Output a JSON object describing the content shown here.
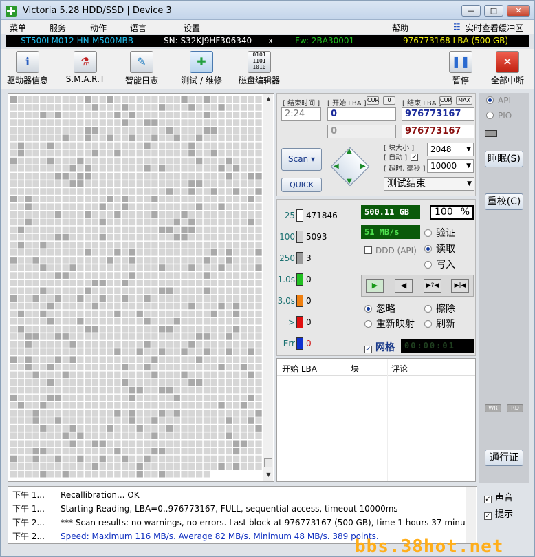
{
  "window": {
    "title": "Victoria 5.28 HDD/SSD | Device 3",
    "min": "—",
    "max": "□",
    "close": "✕"
  },
  "menu": {
    "items": [
      "菜单",
      "服务",
      "动作",
      "语言",
      "设置",
      "帮助"
    ],
    "realtime": "实时查看缓冲区"
  },
  "device": {
    "model": "ST500LM012 HN-M500MBB",
    "serial": "SN: S32KJ9HF306340",
    "x": "x",
    "firmware": "Fw: 2BA30001",
    "capacity": "976773168 LBA (500 GB)"
  },
  "toolbar": {
    "driver_info": "驱动器信息",
    "smart": "S.M.A.R.T",
    "smart_log": "智能日志",
    "test_repair": "测试 / 维修",
    "disk_editor": "磁盘编辑器",
    "pause": "暂停",
    "stop_all": "全部中断"
  },
  "test": {
    "end_time_label": "[ 结束时间 ]",
    "start_lba_label": "[ 开始 LBA ]",
    "end_lba_label": "[ 结束 LBA ]",
    "cur": "CUR",
    "zero": "0",
    "max": "MAX",
    "time": "2:24",
    "start_lba": "0",
    "end_lba": "976773167",
    "start_lba2": "0",
    "end_lba2": "976773167",
    "scan_label": "Scan",
    "quick_label": "QUICK",
    "block_size_label": "[ 块大小 ]",
    "auto_label": "[ 自动 ]",
    "timeout_label": "[ 超时, 毫秒 ]",
    "block_size": "2048",
    "timeout": "10000",
    "status": "测试结束"
  },
  "stats": {
    "rows": [
      {
        "label": "25",
        "count": "471846",
        "color": "#ffffff"
      },
      {
        "label": "100",
        "count": "5093",
        "color": "#d0d0d0"
      },
      {
        "label": "250",
        "count": "3",
        "color": "#9a9a9a"
      },
      {
        "label": "1.0s",
        "count": "0",
        "color": "#22c022"
      },
      {
        "label": "3.0s",
        "count": "0",
        "color": "#f08010"
      },
      {
        "label": ">",
        "count": "0",
        "color": "#e01010"
      },
      {
        "label": "Err",
        "count": "0",
        "color": "#1030d0"
      }
    ],
    "size": "500.11 GB",
    "percent": "100",
    "percent_sign": "%",
    "speed": "51 MB/s",
    "ddd": "DDD (API)",
    "verify": "验证",
    "read": "读取",
    "write": "写入",
    "ignore": "忽略",
    "erase": "擦除",
    "remap": "重新映射",
    "refresh": "刷新",
    "grid_label": "网格",
    "grid_timer": "00:00:01"
  },
  "table": {
    "headers": [
      "开始 LBA",
      "块",
      "评论"
    ]
  },
  "right": {
    "api": "API",
    "pio": "PIO",
    "sleep": "睡眠(S)",
    "recal": "重校(C)",
    "wr": "WR",
    "rd": "RD",
    "passport": "通行证",
    "sound": "声音",
    "hints": "提示"
  },
  "log": {
    "rows": [
      {
        "time": "下午 1...",
        "text": "Recallibration... OK",
        "color": "#000000"
      },
      {
        "time": "下午 1...",
        "text": "Starting Reading, LBA=0..976773167, FULL, sequential access, timeout 10000ms",
        "color": "#000000"
      },
      {
        "time": "下午 2...",
        "text": "*** Scan results: no warnings, no errors. Last block at 976773167 (500 GB), time 1 hours 37 minu...",
        "color": "#000000"
      },
      {
        "time": "下午 2...",
        "text": "Speed: Maximum 116 MB/s. Average 82 MB/s. Minimum 48 MB/s. 389 points.",
        "color": "#1030c0"
      }
    ]
  },
  "watermark": "bbs.38hot.net",
  "colors": {
    "title_bg": "#c4d5ea",
    "lcd_green": "#4fe04f",
    "model": "#22c0f0",
    "firmware": "#22c022",
    "capacity": "#f0f010"
  }
}
